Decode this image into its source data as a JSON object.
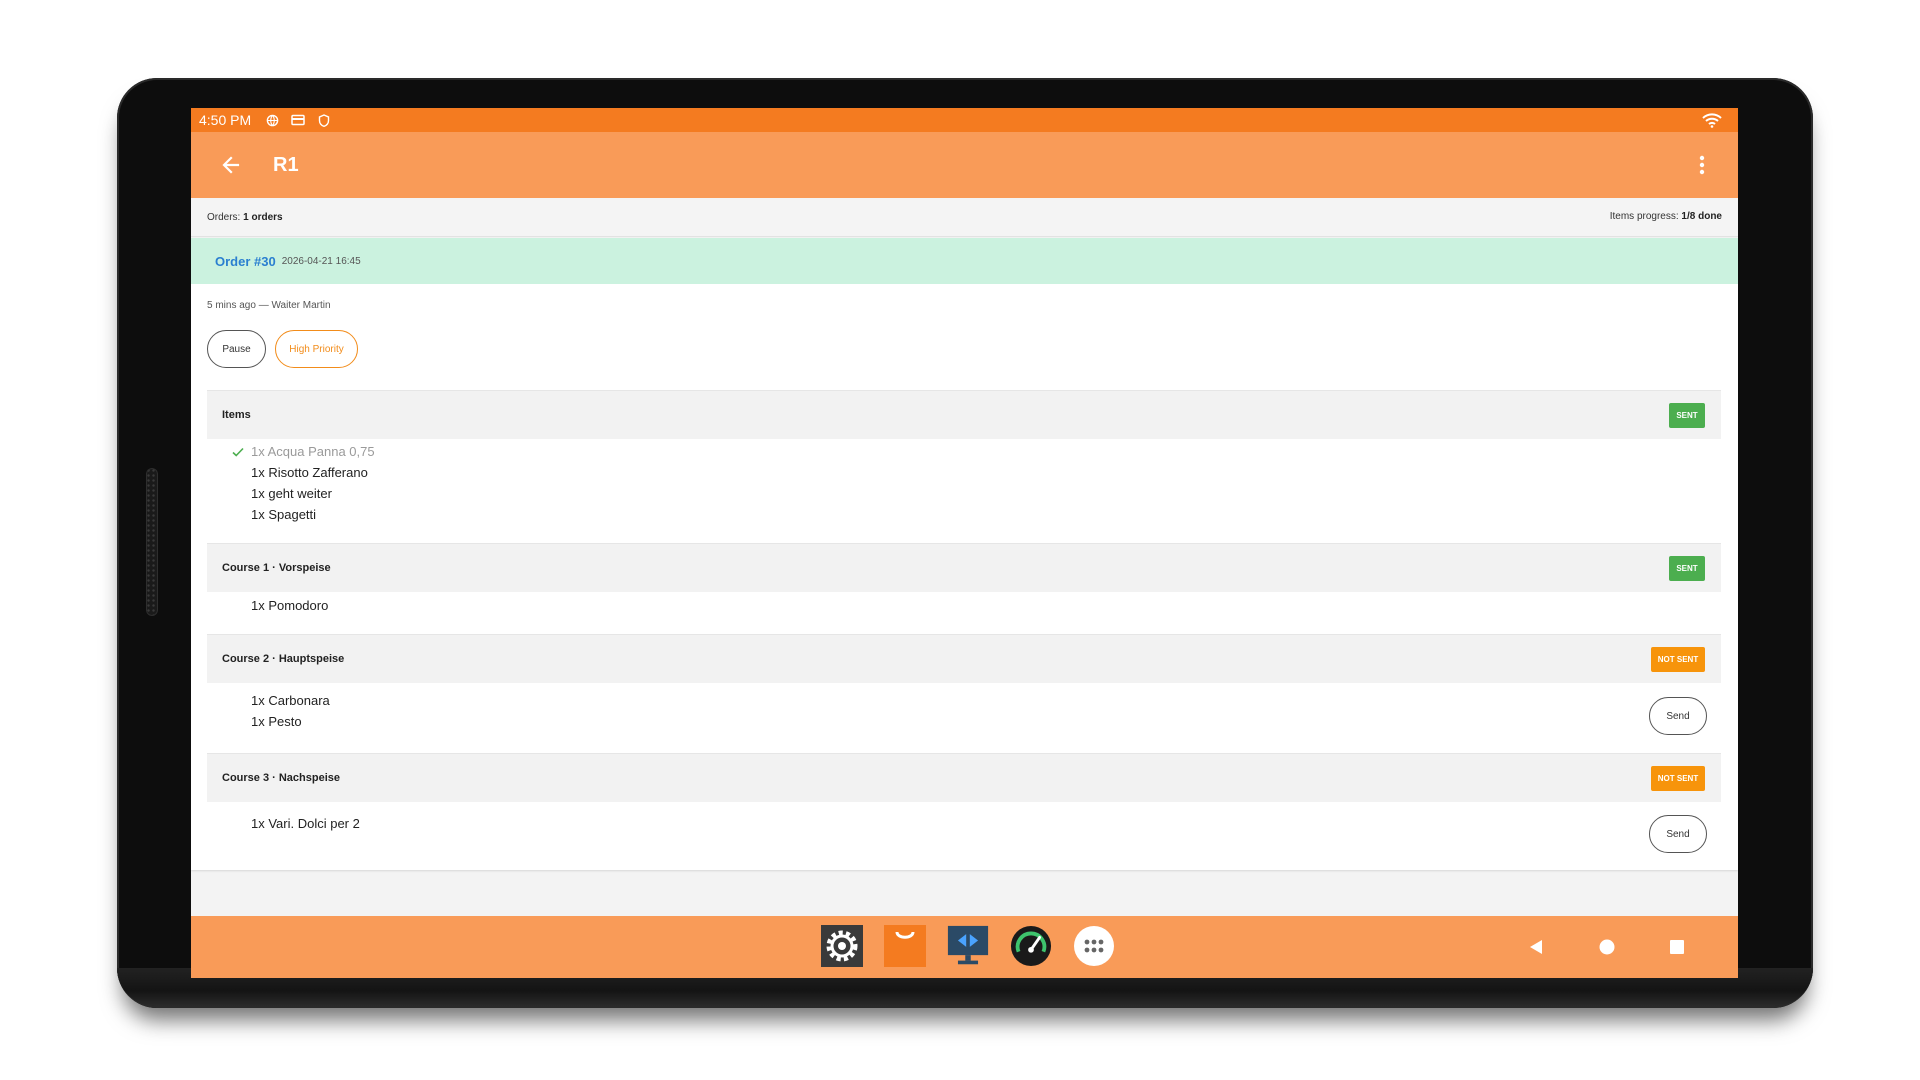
{
  "status_bar": {
    "time": "4:50 PM"
  },
  "app_bar": {
    "title": "R1"
  },
  "summary": {
    "orders_label": "Orders:",
    "orders_value": "1 orders",
    "progress_label": "Items progress:",
    "progress_value": "1/8 done"
  },
  "order": {
    "number": "Order #30",
    "datetime": "2026-04-21 16:45",
    "meta": "5 mins ago — Waiter Martin",
    "pause_label": "Pause",
    "priority_label": "High Priority"
  },
  "sections": [
    {
      "title": "Items",
      "badge": "SENT",
      "items": [
        {
          "text": "1x Acqua Panna 0,75",
          "done": true
        },
        {
          "text": "1x Risotto Zafferano"
        },
        {
          "text": "1x geht weiter"
        },
        {
          "text": "1x Spagetti"
        }
      ]
    },
    {
      "title": "Course 1 · Vorspeise",
      "badge": "SENT",
      "items": [
        {
          "text": "1x Pomodoro"
        }
      ]
    },
    {
      "title": "Course 2 · Hauptspeise",
      "badge": "NOT SENT",
      "send_label": "Send",
      "items": [
        {
          "text": "1x Carbonara"
        },
        {
          "text": "1x Pesto"
        }
      ]
    },
    {
      "title": "Course 3 · Nachspeise",
      "badge": "NOT SENT",
      "send_label": "Send",
      "items": [
        {
          "text": "1x Vari. Dolci per 2"
        }
      ]
    }
  ],
  "dock": {
    "apps": [
      "settings-app-icon",
      "shop-app-icon",
      "remote-desktop-app-icon",
      "speedometer-app-icon",
      "app-drawer-icon"
    ]
  },
  "colors": {
    "status_bar": "#f47b20",
    "app_bar": "#f99b58",
    "order_header": "#cbf2df",
    "order_number": "#2a7fd0",
    "sent": "#4cae4f",
    "not_sent": "#f7940b",
    "priority": "#f28c1a"
  }
}
